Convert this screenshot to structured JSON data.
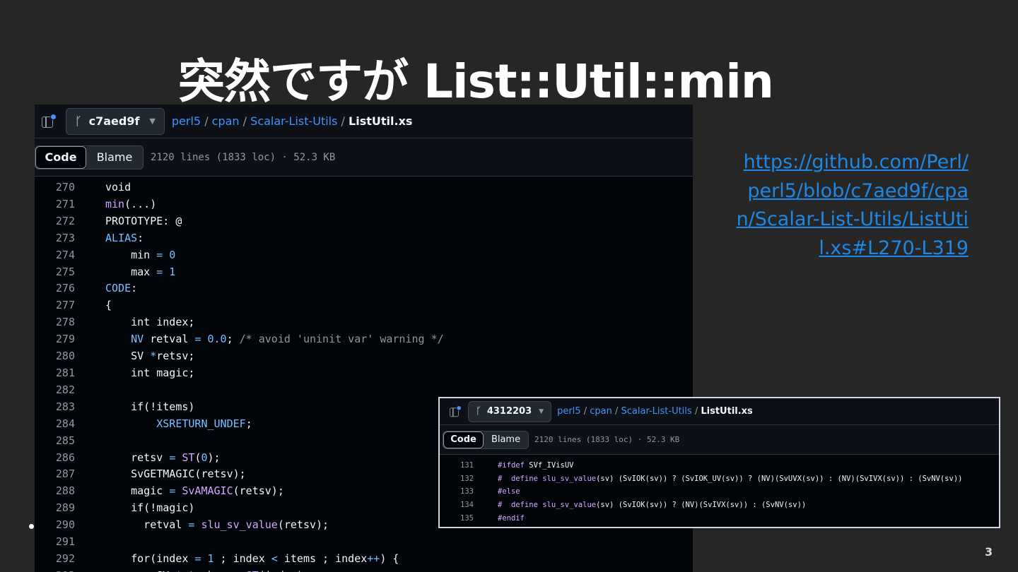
{
  "slide": {
    "title": "突然ですが List::Util::min",
    "url": "https://github.com/Perl/perl5/blob/c7aed9f/cpan/Scalar-List-Utils/ListUtil.xs#L270-L319",
    "page_number": "3"
  },
  "main_panel": {
    "branch": "c7aed9f",
    "breadcrumb": {
      "repo": "perl5",
      "dir1": "cpan",
      "dir2": "Scalar-List-Utils",
      "file": "ListUtil.xs",
      "sep": "/"
    },
    "code_tab": "Code",
    "blame_tab": "Blame",
    "meta": "2120 lines (1833 loc) · 52.3 KB",
    "lines": [
      {
        "n": "270",
        "t": [
          [
            "t",
            "void"
          ]
        ]
      },
      {
        "n": "271",
        "t": [
          [
            "f",
            "min"
          ],
          [
            "t",
            "(...)"
          ]
        ]
      },
      {
        "n": "272",
        "t": [
          [
            "t",
            "PROTOTYPE: @"
          ]
        ]
      },
      {
        "n": "273",
        "t": [
          [
            "k",
            "ALIAS"
          ],
          [
            "t",
            ":"
          ]
        ]
      },
      {
        "n": "274",
        "t": [
          [
            "t",
            "    min "
          ],
          [
            "k",
            "= 0"
          ]
        ]
      },
      {
        "n": "275",
        "t": [
          [
            "t",
            "    max "
          ],
          [
            "k",
            "= 1"
          ]
        ]
      },
      {
        "n": "276",
        "t": [
          [
            "k",
            "CODE"
          ],
          [
            "t",
            ":"
          ]
        ]
      },
      {
        "n": "277",
        "t": [
          [
            "t",
            "{"
          ]
        ]
      },
      {
        "n": "278",
        "t": [
          [
            "t",
            "    int index;"
          ]
        ]
      },
      {
        "n": "279",
        "t": [
          [
            "t",
            "    "
          ],
          [
            "k",
            "NV"
          ],
          [
            "t",
            " retval "
          ],
          [
            "k",
            "= 0.0"
          ],
          [
            "t",
            "; "
          ],
          [
            "m",
            "/* avoid 'uninit var' warning */"
          ]
        ]
      },
      {
        "n": "280",
        "t": [
          [
            "t",
            "    SV "
          ],
          [
            "k",
            "*"
          ],
          [
            "t",
            "retsv;"
          ]
        ]
      },
      {
        "n": "281",
        "t": [
          [
            "t",
            "    int magic;"
          ]
        ]
      },
      {
        "n": "282",
        "t": [
          [
            "t",
            ""
          ]
        ]
      },
      {
        "n": "283",
        "t": [
          [
            "t",
            "    if(!items)"
          ]
        ]
      },
      {
        "n": "284",
        "t": [
          [
            "t",
            "        "
          ],
          [
            "k",
            "XSRETURN_UNDEF"
          ],
          [
            "t",
            ";"
          ]
        ]
      },
      {
        "n": "285",
        "t": [
          [
            "t",
            ""
          ]
        ]
      },
      {
        "n": "286",
        "t": [
          [
            "t",
            "    retsv "
          ],
          [
            "k",
            "="
          ],
          [
            "t",
            " "
          ],
          [
            "f",
            "ST"
          ],
          [
            "t",
            "("
          ],
          [
            "k",
            "0"
          ],
          [
            "t",
            ");"
          ]
        ]
      },
      {
        "n": "287",
        "t": [
          [
            "t",
            "    SvGETMAGIC(retsv);"
          ]
        ]
      },
      {
        "n": "288",
        "t": [
          [
            "t",
            "    magic "
          ],
          [
            "k",
            "="
          ],
          [
            "t",
            " "
          ],
          [
            "f",
            "SvAMAGIC"
          ],
          [
            "t",
            "(retsv);"
          ]
        ]
      },
      {
        "n": "289",
        "t": [
          [
            "t",
            "    if(!magic)"
          ]
        ]
      },
      {
        "n": "290",
        "t": [
          [
            "t",
            "      retval "
          ],
          [
            "k",
            "="
          ],
          [
            "t",
            " "
          ],
          [
            "f",
            "slu_sv_value"
          ],
          [
            "t",
            "(retsv);"
          ]
        ]
      },
      {
        "n": "291",
        "t": [
          [
            "t",
            ""
          ]
        ]
      },
      {
        "n": "292",
        "t": [
          [
            "t",
            "    for(index "
          ],
          [
            "k",
            "= 1"
          ],
          [
            "t",
            " ; index "
          ],
          [
            "k",
            "<"
          ],
          [
            "t",
            " items ; index"
          ],
          [
            "k",
            "++"
          ],
          [
            "t",
            ") {"
          ]
        ]
      },
      {
        "n": "293",
        "t": [
          [
            "t",
            "        SV "
          ],
          [
            "k",
            "*"
          ],
          [
            "t",
            "stacksv "
          ],
          [
            "k",
            "="
          ],
          [
            "t",
            " "
          ],
          [
            "f",
            "ST"
          ],
          [
            "t",
            "(index);"
          ]
        ]
      }
    ]
  },
  "small_panel": {
    "branch": "4312203",
    "breadcrumb": {
      "repo": "perl5",
      "dir1": "cpan",
      "dir2": "Scalar-List-Utils",
      "file": "ListUtil.xs",
      "sep": "/"
    },
    "code_tab": "Code",
    "blame_tab": "Blame",
    "meta": "2120 lines (1833 loc) · 52.3 KB",
    "lines": [
      {
        "n": "131",
        "t": [
          [
            "f",
            "#ifdef"
          ],
          [
            "t",
            " SVf_IVisUV"
          ]
        ]
      },
      {
        "n": "132",
        "t": [
          [
            "f",
            "#  define"
          ],
          [
            "t",
            " "
          ],
          [
            "f",
            "slu_sv_value"
          ],
          [
            "t",
            "(sv) (SvIOK(sv)) ? (SvIOK_UV(sv)) ? (NV)(SvUVX(sv)) : (NV)(SvIVX(sv)) : (SvNV(sv))"
          ]
        ]
      },
      {
        "n": "133",
        "t": [
          [
            "f",
            "#else"
          ]
        ]
      },
      {
        "n": "134",
        "t": [
          [
            "f",
            "#  define"
          ],
          [
            "t",
            " "
          ],
          [
            "f",
            "slu_sv_value"
          ],
          [
            "t",
            "(sv) (SvIOK(sv)) ? (NV)(SvIVX(sv)) : (SvNV(sv))"
          ]
        ]
      },
      {
        "n": "135",
        "t": [
          [
            "f",
            "#endif"
          ]
        ]
      },
      {
        "n": "136",
        "t": [
          [
            "t",
            ""
          ]
        ]
      }
    ]
  },
  "icons": {
    "panel": "sidebar-panel-icon",
    "branch": "git-branch-icon",
    "caret": "caret-down-icon"
  },
  "colors": {
    "background": "#262626",
    "code_bg": "#010409",
    "link": "#4493f8",
    "keyword": "#79c0ff",
    "function": "#d2a8ff",
    "comment": "#9198a1",
    "url": "#1e88e5"
  }
}
